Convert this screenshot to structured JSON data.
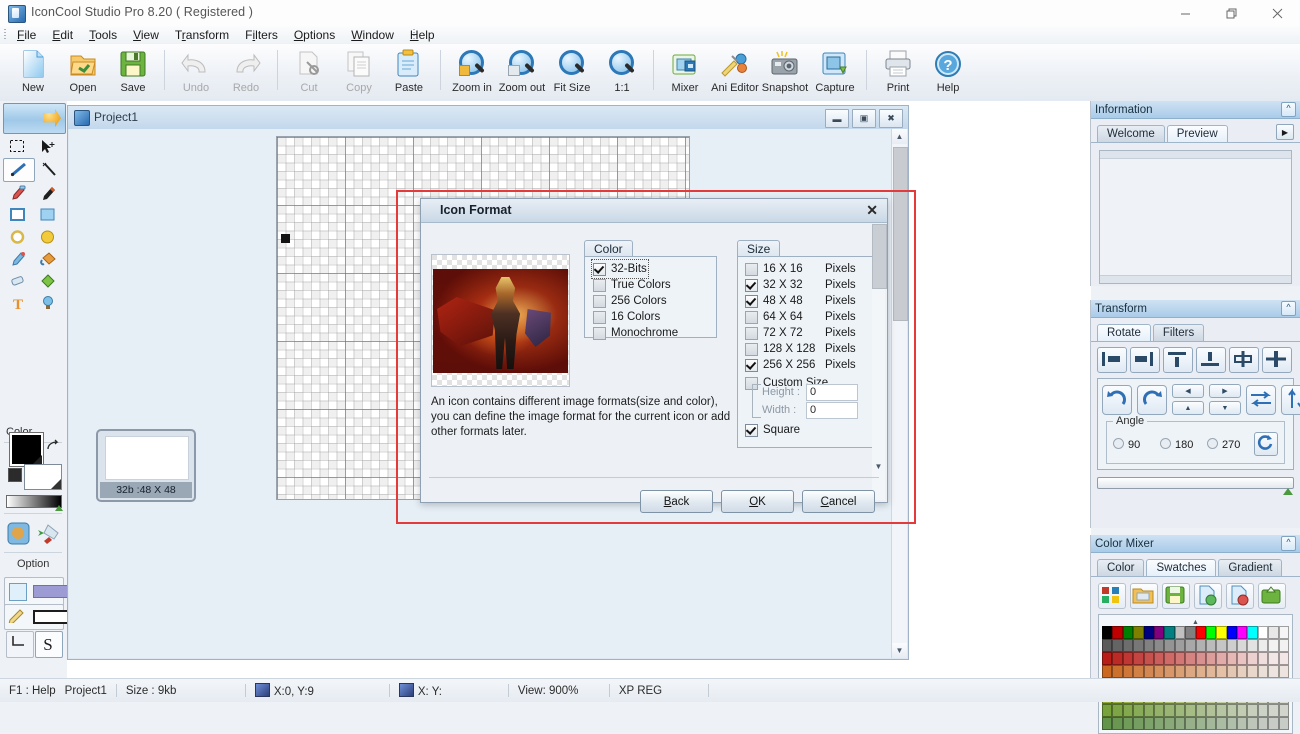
{
  "window": {
    "title": "IconCool Studio Pro 8.20 ( Registered )",
    "minimize": "minimize-icon",
    "restore": "restore-icon",
    "close": "close-icon"
  },
  "menubar": {
    "items": [
      {
        "label": "File",
        "accel": "F"
      },
      {
        "label": "Edit",
        "accel": "E"
      },
      {
        "label": "Tools",
        "accel": "T"
      },
      {
        "label": "View",
        "accel": "V"
      },
      {
        "label": "Transform",
        "accel": "r"
      },
      {
        "label": "Filters",
        "accel": "i"
      },
      {
        "label": "Options",
        "accel": "O"
      },
      {
        "label": "Window",
        "accel": "W"
      },
      {
        "label": "Help",
        "accel": "H"
      }
    ]
  },
  "toolbar": {
    "buttons": [
      {
        "label": "New",
        "icon": "new-document-icon",
        "disabled": false
      },
      {
        "label": "Open",
        "icon": "open-folder-icon",
        "disabled": false
      },
      {
        "label": "Save",
        "icon": "save-floppy-icon",
        "disabled": false
      },
      {
        "label": "Undo",
        "icon": "undo-arrow-icon",
        "disabled": true
      },
      {
        "label": "Redo",
        "icon": "redo-arrow-icon",
        "disabled": true
      },
      {
        "label": "Cut",
        "icon": "cut-scissors-icon",
        "disabled": true
      },
      {
        "label": "Copy",
        "icon": "copy-pages-icon",
        "disabled": true
      },
      {
        "label": "Paste",
        "icon": "paste-clipboard-icon",
        "disabled": false
      },
      {
        "label": "Zoom in",
        "icon": "zoom-in-icon",
        "disabled": false
      },
      {
        "label": "Zoom out",
        "icon": "zoom-out-icon",
        "disabled": false
      },
      {
        "label": "Fit Size",
        "icon": "fit-size-icon",
        "disabled": false
      },
      {
        "label": "1:1",
        "icon": "actual-size-icon",
        "disabled": false
      },
      {
        "label": "Mixer",
        "icon": "mixer-icon",
        "disabled": false
      },
      {
        "label": "Ani Editor",
        "icon": "ani-editor-icon",
        "disabled": false
      },
      {
        "label": "Snapshot",
        "icon": "snapshot-camera-icon",
        "disabled": false
      },
      {
        "label": "Capture",
        "icon": "capture-screen-icon",
        "disabled": false
      },
      {
        "label": "Print",
        "icon": "printer-icon",
        "disabled": false
      },
      {
        "label": "Help",
        "icon": "help-question-icon",
        "disabled": false
      }
    ]
  },
  "tools": {
    "banner": "banner-arrow-icon",
    "items": [
      {
        "icon": "rectangular-marquee-icon",
        "selected": false
      },
      {
        "icon": "move-selection-icon",
        "selected": false
      },
      {
        "icon": "line-tool-icon",
        "selected": true
      },
      {
        "icon": "magic-wand-icon",
        "selected": false
      },
      {
        "icon": "eyedropper-icon",
        "selected": false
      },
      {
        "icon": "paintbrush-icon",
        "selected": false
      },
      {
        "icon": "rectangle-outline-icon",
        "selected": false
      },
      {
        "icon": "rectangle-filled-icon",
        "selected": false
      },
      {
        "icon": "ellipse-outline-icon",
        "selected": false
      },
      {
        "icon": "ellipse-filled-icon",
        "selected": false
      },
      {
        "icon": "airbrush-icon",
        "selected": false
      },
      {
        "icon": "paint-bucket-icon",
        "selected": false
      },
      {
        "icon": "eraser-icon",
        "selected": false
      },
      {
        "icon": "gradient-diamond-icon",
        "selected": false
      },
      {
        "icon": "text-tool-icon",
        "selected": false
      },
      {
        "icon": "effects-bulb-icon",
        "selected": false
      }
    ],
    "color_label": "Color",
    "foreground_color": "#000000",
    "background_color": "#ffffff",
    "swap_icon": "swap-colors-icon",
    "gradient_icon": "gradient-strip",
    "convert_icon": "convert-to-vector-icon",
    "option_label": "Option",
    "option_fill_icon": "fill-style-icon",
    "option_color_bar": "#9d9bd4",
    "option_pencil_icon": "pencil-width-icon",
    "option_line_bar": "line-width-bar",
    "option_corner_icon": "corner-joint-icon",
    "option_smooth_icon": "smooth-s-icon"
  },
  "mdi": {
    "title": "Project1",
    "icon": "project-icon",
    "minimize": "minimize-icon",
    "restore": "restore-icon",
    "close": "close-icon",
    "thumbnail_caption": "32b :48 X 48"
  },
  "dialog": {
    "title": "Icon Format",
    "close": "close-icon",
    "preview_alt": "red-armored-warrior-icon-preview",
    "description": "An icon contains different image formats(size and color), you can define the image format for the current icon or add other formats later.",
    "color_group": {
      "legend": "Color",
      "options": [
        {
          "label": "32-Bits",
          "checked": true,
          "focused": true
        },
        {
          "label": "True Colors",
          "checked": false,
          "focused": false
        },
        {
          "label": "256 Colors",
          "checked": false,
          "focused": false
        },
        {
          "label": "16 Colors",
          "checked": false,
          "focused": false
        },
        {
          "label": "Monochrome",
          "checked": false,
          "focused": false
        }
      ]
    },
    "size_group": {
      "legend": "Size",
      "options": [
        {
          "label": "16 X 16",
          "unit": "Pixels",
          "checked": false
        },
        {
          "label": "32 X 32",
          "unit": "Pixels",
          "checked": true
        },
        {
          "label": "48 X 48",
          "unit": "Pixels",
          "checked": true
        },
        {
          "label": "64 X 64",
          "unit": "Pixels",
          "checked": false
        },
        {
          "label": "72 X 72",
          "unit": "Pixels",
          "checked": false
        },
        {
          "label": "128 X 128",
          "unit": "Pixels",
          "checked": false
        },
        {
          "label": "256 X 256",
          "unit": "Pixels",
          "checked": true
        }
      ],
      "custom_size": {
        "label": "Custom Size",
        "checked": false
      },
      "height_label": "Height :",
      "height_value": "0",
      "width_label": "Width :",
      "width_value": "0",
      "square": {
        "label": "Square",
        "checked": true
      }
    },
    "buttons": [
      {
        "label": "Back",
        "accel": "B"
      },
      {
        "label": "OK",
        "accel": "O"
      },
      {
        "label": "Cancel",
        "accel": "C"
      }
    ]
  },
  "docks": {
    "information": {
      "title": "Information",
      "collapse_icon": "chevron-up-icon",
      "tabs": [
        {
          "label": "Welcome",
          "active": false
        },
        {
          "label": "Preview",
          "active": true
        }
      ],
      "more_icon": "chevron-right-icon"
    },
    "transform": {
      "title": "Transform",
      "collapse_icon": "chevron-up-icon",
      "tabs": [
        {
          "label": "Rotate",
          "active": true
        },
        {
          "label": "Filters",
          "active": false
        }
      ],
      "align_buttons": [
        "align-left-icon",
        "align-right-icon",
        "align-top-icon",
        "align-bottom-icon",
        "align-center-horizontal-icon",
        "align-center-vertical-icon"
      ],
      "rotate_ccw_icon": "rotate-counterclockwise-icon",
      "rotate_cw_icon": "rotate-clockwise-icon",
      "nudge_left_icon": "nudge-left-icon",
      "nudge_right_icon": "nudge-right-icon",
      "nudge_up_icon": "nudge-up-icon",
      "nudge_down_icon": "nudge-down-icon",
      "flip_horizontal_icon": "flip-horizontal-icon",
      "flip_vertical_icon": "flip-vertical-icon",
      "angle_label": "Angle",
      "angles": [
        {
          "label": "90",
          "selected": false
        },
        {
          "label": "180",
          "selected": false
        },
        {
          "label": "270",
          "selected": false
        }
      ],
      "free_rotate_icon": "free-rotate-icon"
    },
    "color_mixer": {
      "title": "Color Mixer",
      "collapse_icon": "chevron-up-icon",
      "tabs": [
        {
          "label": "Color",
          "active": false
        },
        {
          "label": "Swatches",
          "active": true
        },
        {
          "label": "Gradient",
          "active": false
        }
      ],
      "buttons": [
        "palette-shuffle-icon",
        "open-palette-icon",
        "save-palette-icon",
        "add-swatch-icon",
        "delete-swatch-icon",
        "export-palette-icon"
      ],
      "expand_icon": "chevron-up-small-icon",
      "swatch_base_colors": [
        "#000000",
        "#c00000",
        "#008000",
        "#808000",
        "#000080",
        "#800080",
        "#008080",
        "#c0c0c0",
        "#808080",
        "#ff0000",
        "#00ff00",
        "#ffff00",
        "#0000ff",
        "#ff00ff",
        "#00ffff",
        "#ffffff",
        "#e8e8e8",
        "#f5f5f5"
      ]
    }
  },
  "statusbar": {
    "help": "F1 : Help",
    "project": "Project1",
    "size": "Size : 9kb",
    "cursor_icon": "cursor-position-icon",
    "cursor": "X:0, Y:9",
    "selection_icon": "selection-size-icon",
    "selection": "X: Y:",
    "view": "View: 900%",
    "mode": "XP REG"
  }
}
